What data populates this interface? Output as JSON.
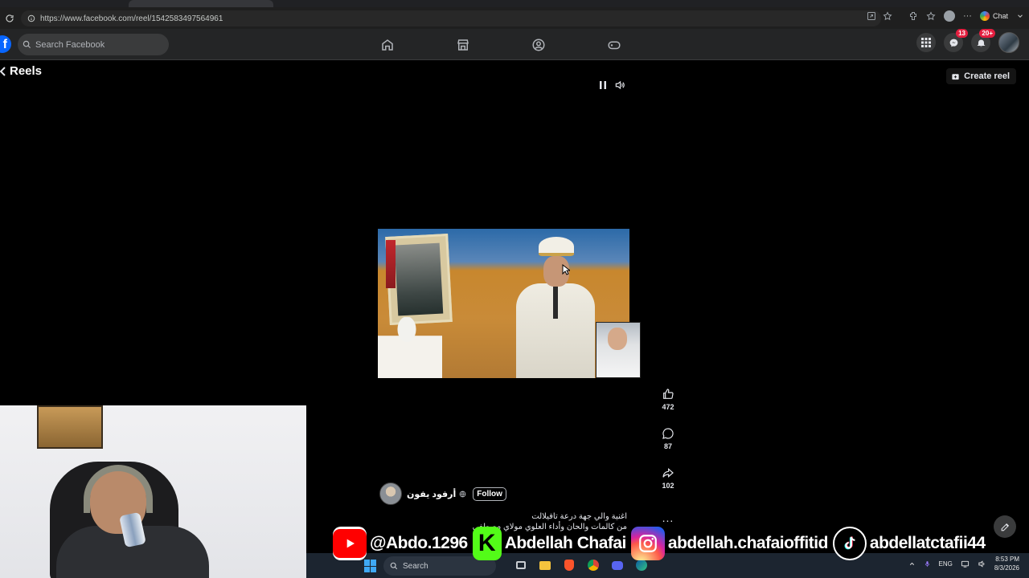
{
  "browser": {
    "url": "https://www.facebook.com/reel/1542583497564961",
    "chat_label": "Chat"
  },
  "facebook": {
    "logo": "f",
    "search_placeholder": "Search Facebook",
    "nav_icons": [
      "home-icon",
      "marketplace-icon",
      "groups-icon",
      "gaming-icon"
    ],
    "messenger_badge": "13",
    "notifications_badge": "20+"
  },
  "reels": {
    "title": "Reels",
    "create_reel_label": "Create reel"
  },
  "reel": {
    "likes": "472",
    "comments": "87",
    "shares": "102",
    "more": "...",
    "author_name": "أرفود يفون",
    "follow_label": "Follow",
    "caption_line1": "اغنية والي جهة درعة تافيلالت",
    "caption_line2": "من كالمات والحان وأداء العلوي مولاي مصطفى"
  },
  "socials": {
    "youtube": "@Abdo.1296",
    "kick": "Abdellah Chafai",
    "kick_letter": "K",
    "instagram": "abdellah.chafaioffitid",
    "tiktok": "abdellatctafii44"
  },
  "taskbar": {
    "search_label": "Search",
    "language": "ENG",
    "time": "8:53 PM",
    "date": "8/3/2026"
  },
  "colors": {
    "fb_blue": "#0866ff",
    "badge_red": "#e41e3f",
    "kick_green": "#53fc18",
    "youtube_red": "#ff0000"
  }
}
